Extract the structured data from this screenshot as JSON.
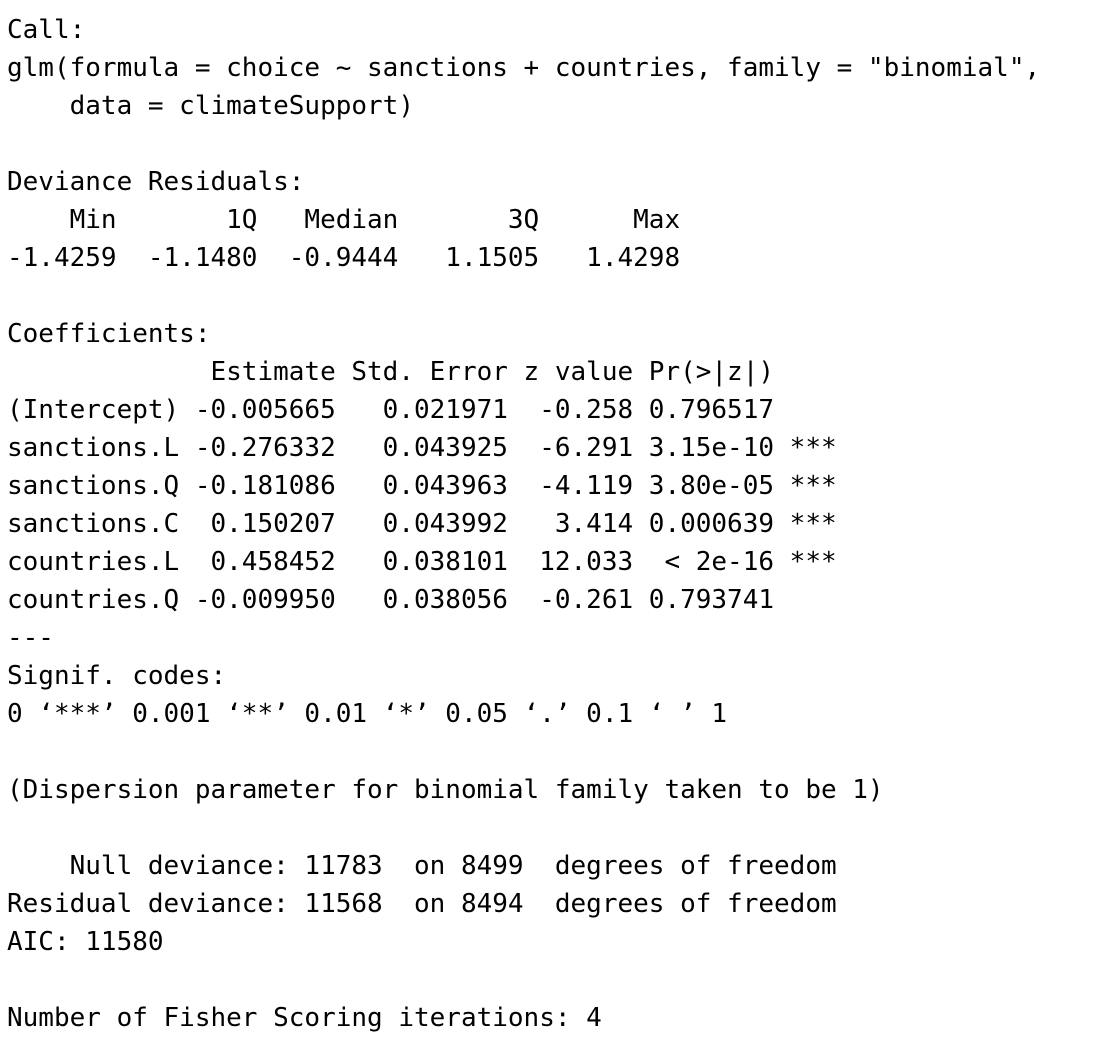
{
  "console": {
    "call_header": "Call:",
    "call_line_1": "glm(formula = choice ~ sanctions + countries, family = \"binomial\",",
    "call_line_2": "    data = climateSupport)",
    "blank_1": "",
    "deviance_header": "Deviance Residuals:",
    "deviance_labels": "    Min       1Q   Median       3Q      Max  ",
    "deviance_values": "-1.4259  -1.1480  -0.9444   1.1505   1.4298  ",
    "blank_2": "",
    "coef_header": "Coefficients:",
    "coef_columns": "             Estimate Std. Error z value Pr(>|z|)    ",
    "coef_rows": [
      "(Intercept) -0.005665   0.021971  -0.258 0.796517    ",
      "sanctions.L -0.276332   0.043925  -6.291 3.15e-10 ***",
      "sanctions.Q -0.181086   0.043963  -4.119 3.80e-05 ***",
      "sanctions.C  0.150207   0.043992   3.414 0.000639 ***",
      "countries.L  0.458452   0.038101  12.033  < 2e-16 ***",
      "countries.Q -0.009950   0.038056  -0.261 0.793741    "
    ],
    "separator": "---",
    "signif_header": "Signif. codes:",
    "signif_codes": "0 ‘***’ 0.001 ‘**’ 0.01 ‘*’ 0.05 ‘.’ 0.1 ‘ ’ 1",
    "blank_3": "",
    "dispersion": "(Dispersion parameter for binomial family taken to be 1)",
    "blank_4": "",
    "null_deviance": "    Null deviance: 11783  on 8499  degrees of freedom",
    "residual_deviance": "Residual deviance: 11568  on 8494  degrees of freedom",
    "aic": "AIC: 11580",
    "blank_5": "",
    "fisher": "Number of Fisher Scoring iterations: 4"
  }
}
